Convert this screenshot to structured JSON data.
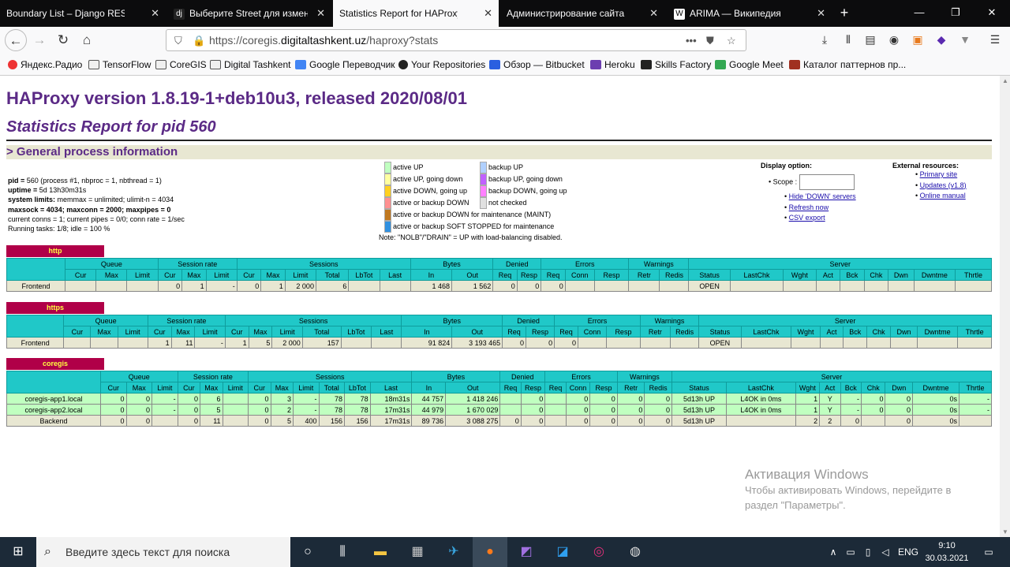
{
  "browser": {
    "tabs": [
      {
        "title": "Boundary List – Django REST frame",
        "icon": "django-icon"
      },
      {
        "title": "Выберите Street для изменени",
        "icon": "django-icon"
      },
      {
        "title": "Statistics Report for HAProxy",
        "icon": ""
      },
      {
        "title": "Администрирование сайта | Адми",
        "icon": ""
      },
      {
        "title": "ARIMA — Википедия",
        "icon": "wikipedia-icon"
      }
    ],
    "new_tab": "+",
    "url_prefix": "https://coregis.",
    "url_domain": "digitaltashkent.uz",
    "url_path": "/haproxy?stats",
    "page_actions": "•••",
    "bookmarks": [
      "Яндекс.Радио",
      "TensorFlow",
      "CoreGIS",
      "Digital Tashkent",
      "Google Переводчик",
      "Your Repositories",
      "Обзор — Bitbucket",
      "Heroku",
      "Skills Factory",
      "Google Meet",
      "Каталог паттернов пр..."
    ]
  },
  "page": {
    "title": "HAProxy version 1.8.19-1+deb10u3, released 2020/08/01",
    "subtitle": "Statistics Report for pid 560",
    "section": "> General process information",
    "process_info": [
      {
        "label": "pid = ",
        "value": "560 (process #1, nbproc = 1, nbthread = 1)"
      },
      {
        "label": "uptime = ",
        "value": "5d 13h30m31s"
      },
      {
        "label": "system limits:",
        "value": " memmax = unlimited; ulimit-n = 4034"
      },
      {
        "label": "maxsock = ",
        "value": "4034; "
      },
      {
        "label": "",
        "value": "current conns = 1; current pipes = 0/0; conn rate = 1/sec"
      },
      {
        "label": "",
        "value": "Running tasks: 1/8; idle = 100 %"
      }
    ],
    "maxconn_line": "maxsock = 4034; maxconn = 2000; maxpipes = 0",
    "legend_left": [
      {
        "label": "active UP",
        "color": "#c0ffc0"
      },
      {
        "label": "active UP, going down",
        "color": "#ffffa0"
      },
      {
        "label": "active DOWN, going up",
        "color": "#ffd020"
      },
      {
        "label": "active or backup DOWN",
        "color": "#ff9090"
      },
      {
        "label": "active or backup DOWN for maintenance (MAINT)",
        "color": "#c07820"
      },
      {
        "label": "active or backup SOFT STOPPED for maintenance",
        "color": "#3090e0"
      }
    ],
    "legend_right": [
      {
        "label": "backup UP",
        "color": "#b0d0ff"
      },
      {
        "label": "backup UP, going down",
        "color": "#c060ff"
      },
      {
        "label": "backup DOWN, going up",
        "color": "#ff80ff"
      },
      {
        "label": "not checked",
        "color": "#e0e0e0"
      }
    ],
    "legend_note": "Note: \"NOLB\"/\"DRAIN\" = UP with load-balancing disabled.",
    "display_option": {
      "title": "Display option:",
      "scope_label": "Scope :",
      "scope_value": "",
      "links": [
        "Hide 'DOWN' servers",
        "Refresh now",
        "CSV export"
      ]
    },
    "external": {
      "title": "External resources:",
      "links": [
        "Primary site",
        "Updates (v1.8)",
        "Online manual"
      ]
    },
    "columns": {
      "groups": [
        "Queue",
        "Session rate",
        "Sessions",
        "Bytes",
        "Denied",
        "Errors",
        "Warnings",
        "Server"
      ],
      "sub": [
        "Cur",
        "Max",
        "Limit",
        "Cur",
        "Max",
        "Limit",
        "Cur",
        "Max",
        "Limit",
        "Total",
        "LbTot",
        "Last",
        "In",
        "Out",
        "Req",
        "Resp",
        "Req",
        "Conn",
        "Resp",
        "Retr",
        "Redis",
        "Status",
        "LastChk",
        "Wght",
        "Act",
        "Bck",
        "Chk",
        "Dwn",
        "Dwntme",
        "Thrtle"
      ]
    },
    "proxies": [
      {
        "name": "http",
        "rows": [
          [
            "Frontend",
            "",
            "",
            "",
            "0",
            "1",
            "-",
            "0",
            "1",
            "2 000",
            "6",
            "",
            "",
            "1 468",
            "1 562",
            "0",
            "0",
            "0",
            "",
            "",
            "",
            "",
            "OPEN",
            "",
            "",
            "",
            "",
            "",
            "",
            "",
            ""
          ]
        ]
      },
      {
        "name": "https",
        "rows": [
          [
            "Frontend",
            "",
            "",
            "",
            "1",
            "11",
            "-",
            "1",
            "5",
            "2 000",
            "157",
            "",
            "",
            "91 824",
            "3 193 465",
            "0",
            "0",
            "0",
            "",
            "",
            "",
            "",
            "OPEN",
            "",
            "",
            "",
            "",
            "",
            "",
            "",
            ""
          ]
        ]
      },
      {
        "name": "coregis",
        "rows": [
          [
            "coregis-app1.local",
            "0",
            "0",
            "-",
            "0",
            "6",
            "",
            "0",
            "3",
            "-",
            "78",
            "78",
            "18m31s",
            "44 757",
            "1 418 246",
            "",
            "0",
            "",
            "0",
            "0",
            "0",
            "0",
            "5d13h UP",
            "L4OK in 0ms",
            "1",
            "Y",
            "-",
            "0",
            "0",
            "0s",
            "-"
          ],
          [
            "coregis-app2.local",
            "0",
            "0",
            "-",
            "0",
            "5",
            "",
            "0",
            "2",
            "-",
            "78",
            "78",
            "17m31s",
            "44 979",
            "1 670 029",
            "",
            "0",
            "",
            "0",
            "0",
            "0",
            "0",
            "5d13h UP",
            "L4OK in 0ms",
            "1",
            "Y",
            "-",
            "0",
            "0",
            "0s",
            "-"
          ],
          [
            "Backend",
            "0",
            "0",
            "",
            "0",
            "11",
            "",
            "0",
            "5",
            "400",
            "156",
            "156",
            "17m31s",
            "89 736",
            "3 088 275",
            "0",
            "0",
            "",
            "0",
            "0",
            "0",
            "0",
            "5d13h UP",
            "",
            "2",
            "2",
            "0",
            "",
            "0",
            "0s",
            ""
          ]
        ]
      }
    ]
  },
  "watermark": {
    "title": "Активация Windows",
    "line1": "Чтобы активировать Windows, перейдите в",
    "line2": "раздел \"Параметры\"."
  },
  "taskbar": {
    "search_placeholder": "Введите здесь текст для поиска",
    "lang": "ENG",
    "time": "9:10",
    "date": "30.03.2021"
  }
}
